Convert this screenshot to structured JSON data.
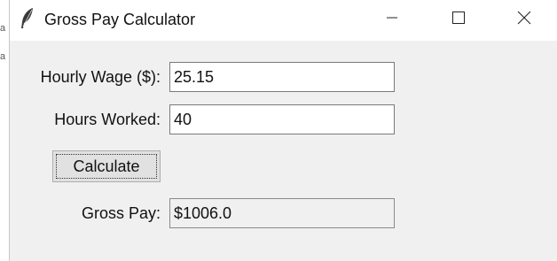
{
  "window": {
    "title": "Gross Pay Calculator",
    "app_icon": "feather-icon",
    "controls": [
      "minimize-icon",
      "maximize-icon",
      "close-icon"
    ]
  },
  "form": {
    "hourly_wage_label": "Hourly Wage ($):",
    "hourly_wage_value": "25.15",
    "hours_worked_label": "Hours Worked:",
    "hours_worked_value": "40",
    "calculate_label": "Calculate",
    "gross_pay_label": "Gross Pay:",
    "gross_pay_value": "$1006.0"
  },
  "desktop": {
    "edge_glyphs": [
      "a",
      "a"
    ]
  }
}
